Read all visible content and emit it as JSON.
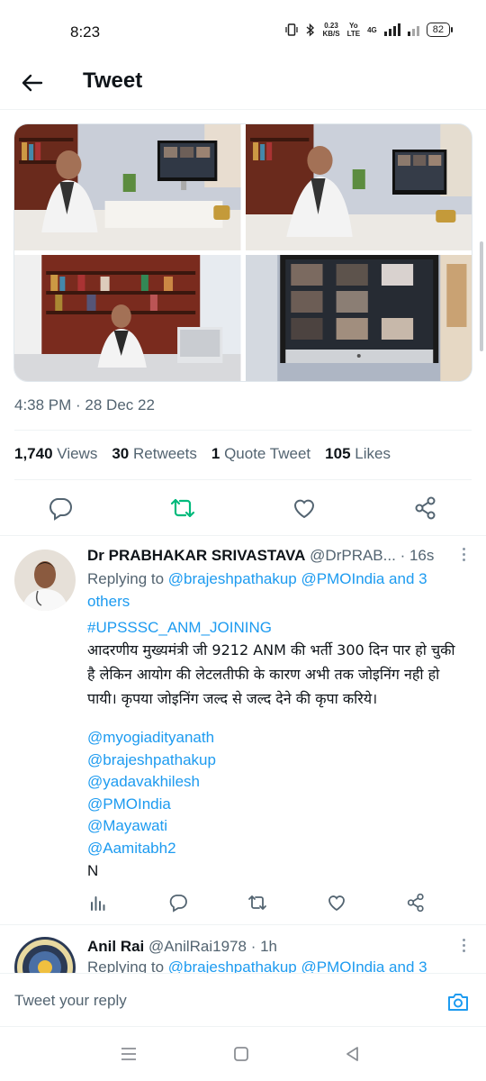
{
  "status_bar": {
    "time": "8:23",
    "net_speed_value": "0.23",
    "net_speed_unit": "KB/S",
    "volte_top": "Yo",
    "volte_bottom": "LTE",
    "network_type": "4G",
    "battery": "82"
  },
  "header": {
    "title": "Tweet"
  },
  "tweet": {
    "timestamp": "4:38 PM · 28 Dec 22",
    "stats": {
      "views_count": "1,740",
      "views_label": "Views",
      "retweets_count": "30",
      "retweets_label": "Retweets",
      "quotes_count": "1",
      "quotes_label": "Quote Tweet",
      "likes_count": "105",
      "likes_label": "Likes"
    },
    "accent_color": "#1d9bf0",
    "retweet_color": "#00ba7c"
  },
  "replies": [
    {
      "name": "Dr PRABHAKAR SRIVASTAVA",
      "handle": "@DrPRAB...",
      "time": "· 16s",
      "replying_prefix": "Replying to",
      "replying_links": "@brajeshpathakup @PMOIndia and 3 others",
      "hashtag": "#UPSSSC_ANM_JOINING",
      "body": "आदरणीय मुख्यमंत्री जी 9212 ANM की भर्ती 300 दिन पार हो चुकी है लेकिन आयोग की लेटलतीफी के कारण अभी तक जोइनिंग नही हो पायी। कृपया जोइनिंग जल्द से जल्द देने की कृपा करिये।",
      "mentions": [
        "@myogiadityanath",
        "@brajeshpathakup",
        "@yadavakhilesh",
        "@PMOIndia",
        "@Mayawati",
        "@Aamitabh2"
      ],
      "last_line": "N"
    },
    {
      "name": "Anil Rai",
      "handle": "@AnilRai1978",
      "time": "· 1h",
      "replying_prefix": "Replying to",
      "replying_links": "@brajeshpathakup @PMOIndia and 3"
    }
  ],
  "reply_bar": {
    "placeholder": "Tweet your reply"
  }
}
